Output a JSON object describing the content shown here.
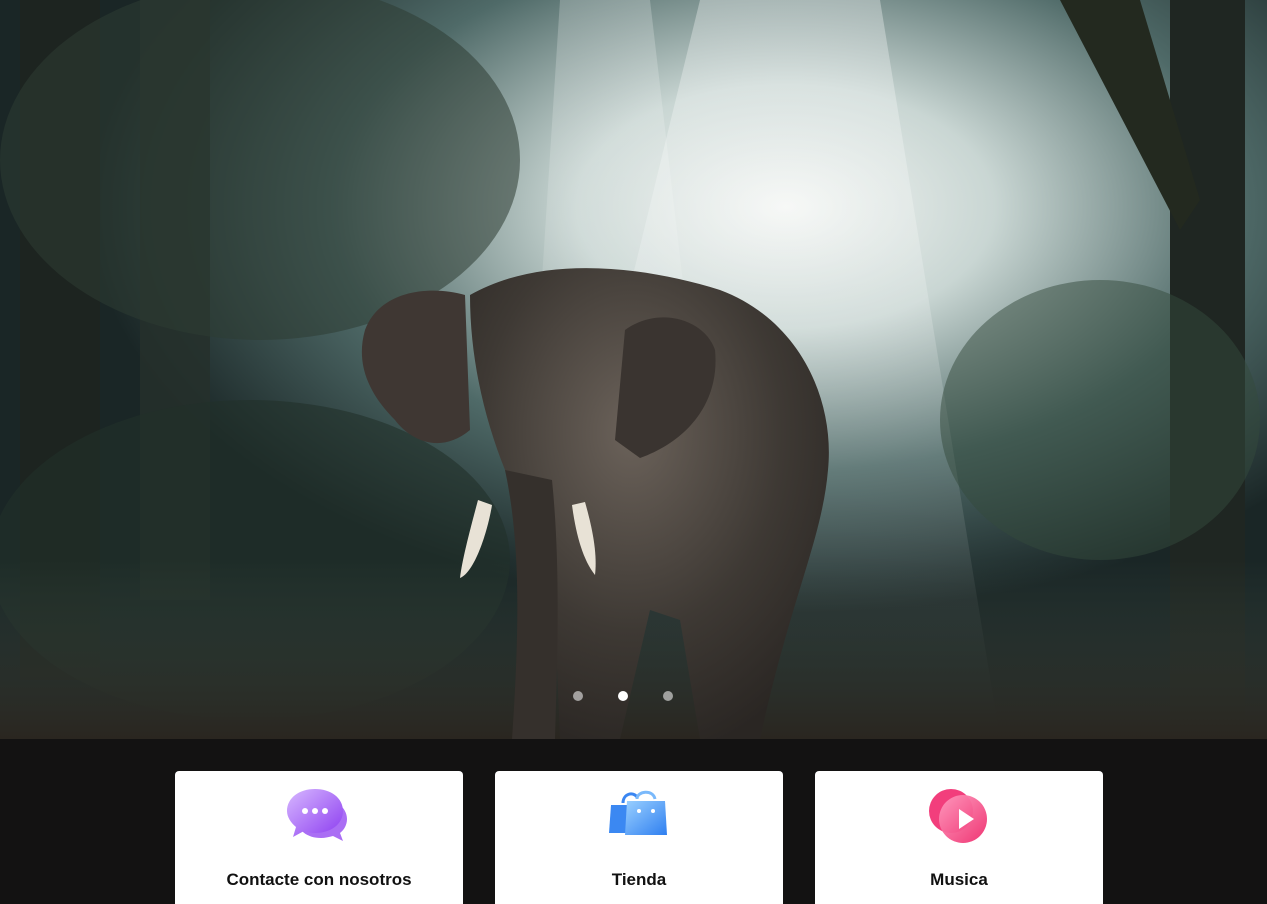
{
  "hero": {
    "slides": 3,
    "active_slide": 2,
    "dots": [
      "slide-1",
      "slide-2",
      "slide-3"
    ]
  },
  "cards": [
    {
      "label": "Contacte con nosotros",
      "icon": "chat-bubbles-icon",
      "accent": "#a865f5"
    },
    {
      "label": "Tienda",
      "icon": "shopping-bag-icon",
      "accent": "#3b8ef6"
    },
    {
      "label": "Musica",
      "icon": "music-play-icon",
      "accent": "#f03d7a"
    }
  ]
}
